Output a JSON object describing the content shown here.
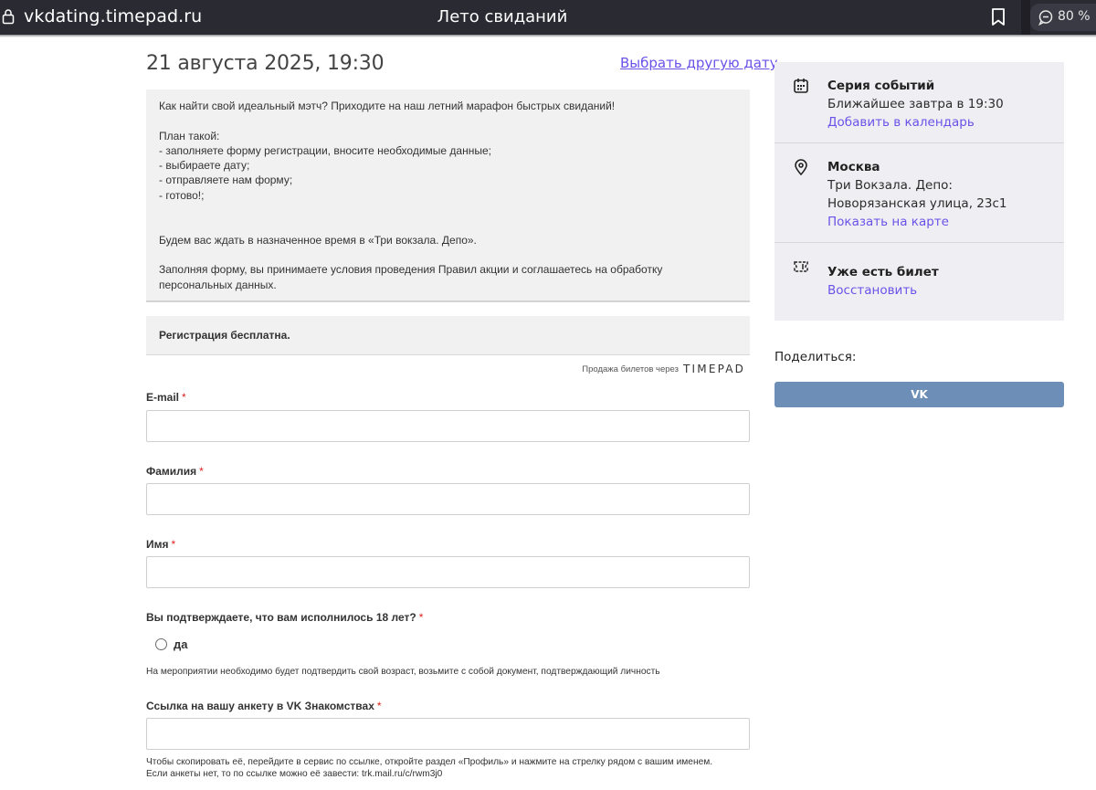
{
  "browser": {
    "domain": "vkdating.timepad.ru",
    "page_title": "Лето свиданий",
    "zoom": "80 %"
  },
  "event": {
    "date": "21 августа 2025, 19:30",
    "other_date_link": "Выбрать другую дату",
    "description": "Как найти свой идеальный мэтч? Приходите на наш летний марафон быстрых свиданий!\n\nПлан такой:\n- заполняете форму регистрации, вносите необходимые данные;\n- выбираете дату;\n- отправляете нам форму;\n- готово!;\n\n\nБудем вас ждать в назначенное время в «Три вокзала. Депо».\n\nЗаполняя форму, вы принимаете условия проведения Правил акции и соглашаетесь на обработку персональных данных.",
    "registration_note": "Регистрация бесплатна.",
    "sale_through": "Продажа билетов через",
    "sale_logo": "TIMEPAD"
  },
  "form": {
    "email_label": "E-mail",
    "surname_label": "Фамилия",
    "name_label": "Имя",
    "age_question": "Вы подтверждаете, что вам исполнилось 18 лет?",
    "age_option": "да",
    "age_hint": "На мероприятии необходимо будет подтвердить свой возраст, возьмите с собой документ, подтверждающий личность",
    "vk_profile_label": "Ссылка на вашу анкету в VK Знакомствах",
    "vk_profile_hint_1": "Чтобы скопировать её, перейдите в сервис по ссылке, откройте раздел «Профиль» и нажмите на стрелку рядом с вашим именем.",
    "vk_profile_hint_2": "Если анкеты нет, то по ссылке можно её завести: trk.mail.ru/c/rwm3j0",
    "required_mark": "*"
  },
  "sidebar": {
    "series_title": "Серия событий",
    "series_text": "Ближайшее завтра в 19:30",
    "series_link": "Добавить в календарь",
    "location_title": "Москва",
    "location_text": "Три Вокзала. Депо: Новорязанская улица, 23с1",
    "location_link": "Показать на карте",
    "ticket_title": "Уже есть билет",
    "ticket_link": "Восстановить",
    "share_label": "Поделиться:",
    "vk_button": "VK"
  },
  "colors": {
    "accent_link": "#6a52e8",
    "required": "#e0201c",
    "vk_button": "#6d8fb7",
    "topbar": "#2a2a32"
  }
}
